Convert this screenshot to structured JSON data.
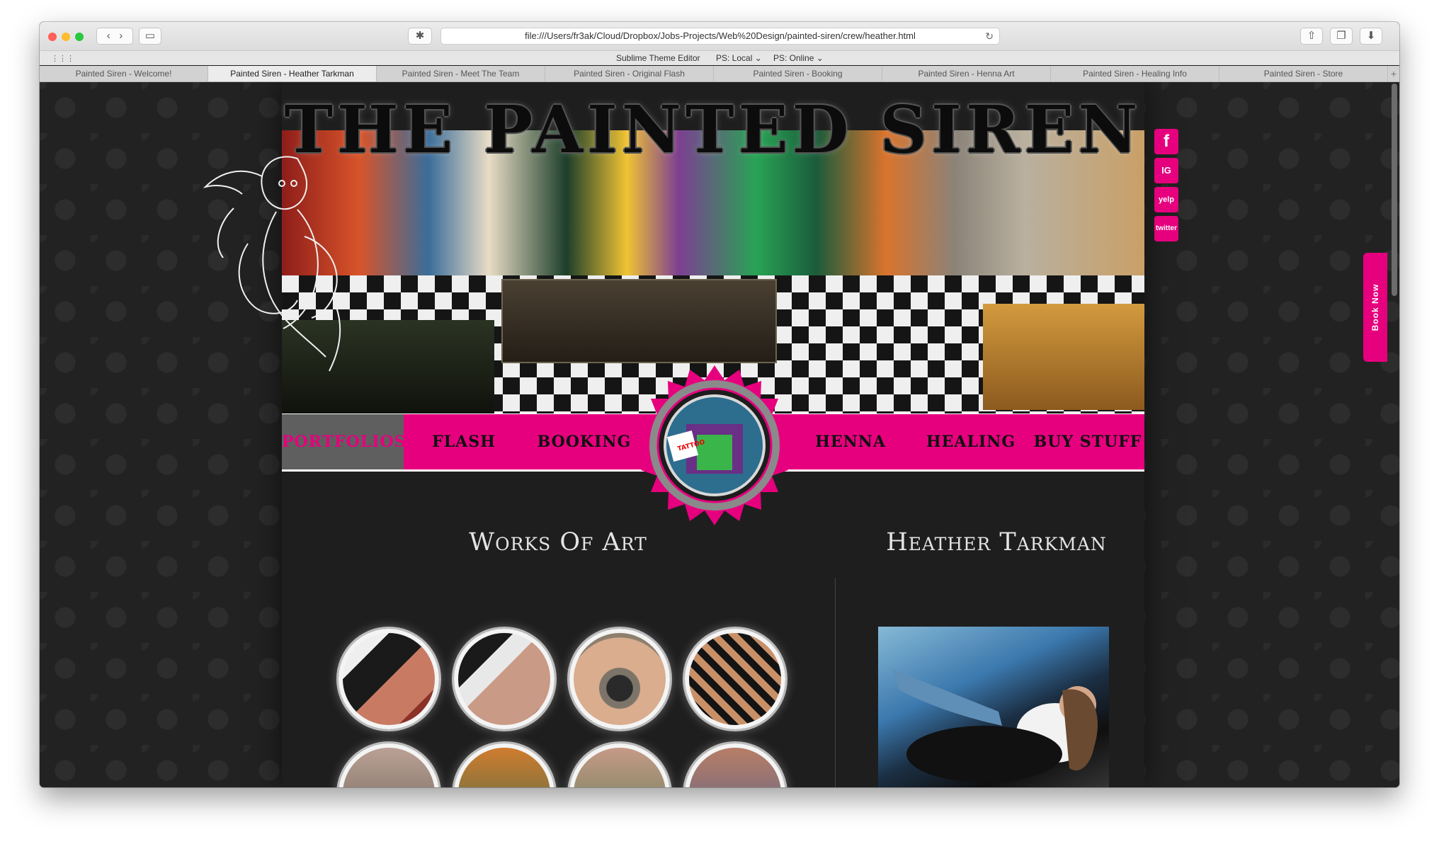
{
  "browser": {
    "url": "file:///Users/fr3ak/Cloud/Dropbox/Jobs-Projects/Web%20Design/painted-siren/crew/heather.html",
    "favorites": [
      "Sublime Theme Editor",
      "PS: Local ⌄",
      "PS: Online ⌄"
    ],
    "tabs": [
      "Painted Siren - Welcome!",
      "Painted Siren - Heather Tarkman",
      "Painted Siren - Meet The Team",
      "Painted Siren - Original Flash",
      "Painted Siren - Booking",
      "Painted Siren - Henna Art",
      "Painted Siren - Healing Info",
      "Painted Siren - Store"
    ],
    "new_tab": "+",
    "active_tab_index": 1
  },
  "site": {
    "title": "THE PAINTED SIREN",
    "social": [
      "f",
      "IG",
      "yelp",
      "twitter"
    ],
    "social_icons": [
      "facebook-icon",
      "instagram-icon",
      "yelp-icon",
      "twitter-icon"
    ],
    "nav": [
      "PORTFOLIOS",
      "FLASH",
      "BOOKING",
      "HENNA",
      "HEALING",
      "BUY STUFF"
    ],
    "active_nav": "PORTFOLIOS",
    "badge_text": "TATTOO",
    "works_title": "Works Of Art",
    "artist_name": "Heather Tarkman",
    "book_now": "Book Now",
    "colors": {
      "accent": "#e6007e",
      "nav_text": "#111111",
      "active_nav_bg": "#5f5f5f"
    }
  }
}
